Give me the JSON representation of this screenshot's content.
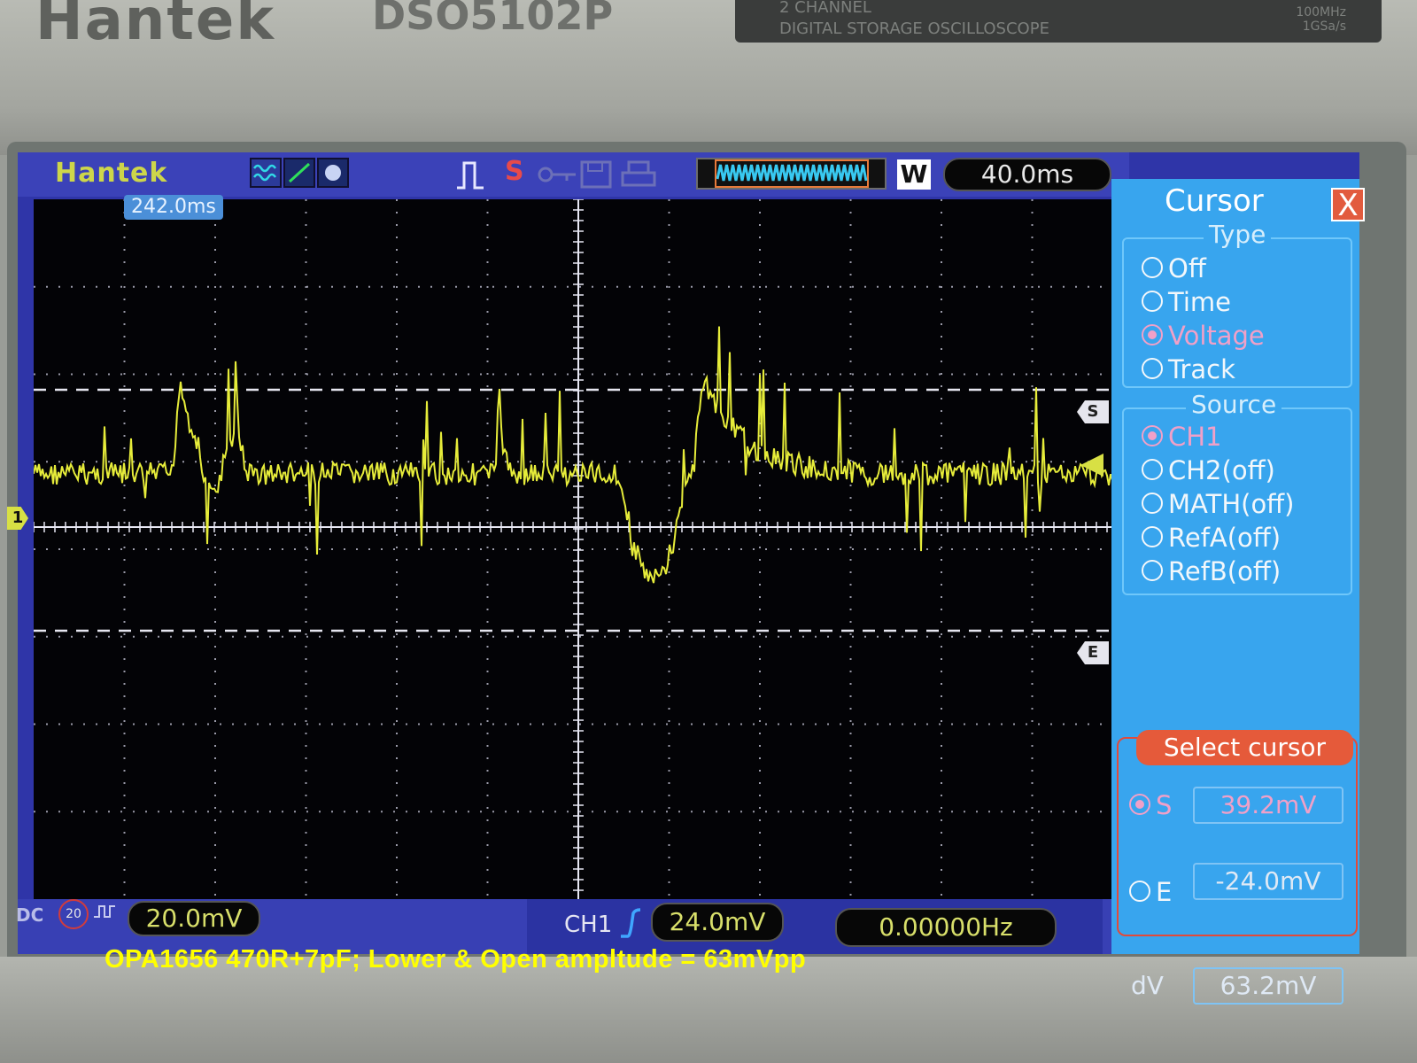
{
  "device": {
    "brand": "Hantek",
    "model": "DSO5102P",
    "subtitle_line1": "2 CHANNEL",
    "subtitle_line2": "DIGITAL STORAGE OSCILLOSCOPE",
    "spec_line1": "100MHz",
    "spec_line2": "1GSa/s"
  },
  "screen": {
    "logo": "Hantek",
    "run_status": "S",
    "window_button": "W",
    "timebase": "40.0ms",
    "trigger_position": "242.0ms",
    "cursor_start_marker": "S",
    "cursor_end_marker": "E",
    "channel_marker": "1"
  },
  "bottom": {
    "coupling": "DC",
    "bw_limit": "20",
    "volts_per_div": "20.0mV",
    "trigger_channel": "CH1",
    "trigger_level": "24.0mV",
    "frequency": "0.00000Hz"
  },
  "cursor_panel": {
    "title": "Cursor",
    "close": "X",
    "type_label": "Type",
    "type_options": [
      "Off",
      "Time",
      "Voltage",
      "Track"
    ],
    "type_selected": "Voltage",
    "source_label": "Source",
    "source_options": [
      "CH1",
      "CH2(off)",
      "MATH(off)",
      "RefA(off)",
      "RefB(off)"
    ],
    "source_selected": "CH1",
    "select_cursor_label": "Select cursor",
    "s_label": "S",
    "s_value": "39.2mV",
    "e_label": "E",
    "e_value": "-24.0mV",
    "dv_label": "dV",
    "dv_value": "63.2mV"
  },
  "caption": "OPA1656 470R+7pF; Lower & Open ampltude = 63mVpp",
  "colors": {
    "trace": "#e6ec3a",
    "display_bg": "#2f35a8",
    "panel_bg": "#38a5ee",
    "caption": "#ffff00",
    "accent": "#e55a3a"
  }
}
